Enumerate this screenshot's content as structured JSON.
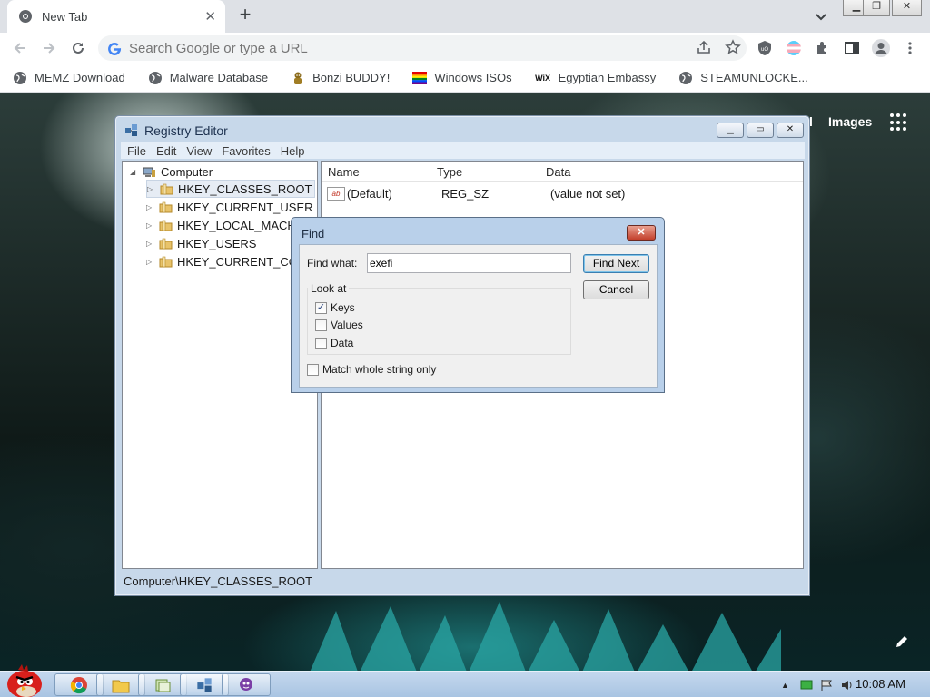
{
  "browser": {
    "tab_title": "New Tab",
    "tab_close": "✕",
    "new_tab": "+",
    "omnibox_placeholder": "Search Google or type a URL",
    "bookmarks": [
      {
        "label": "MEMZ Download",
        "icon": "globe-icon"
      },
      {
        "label": "Malware Database",
        "icon": "globe-icon"
      },
      {
        "label": "Bonzi BUDDY!",
        "icon": "bonzi-icon"
      },
      {
        "label": "Windows ISOs",
        "icon": "rainbow-flag-icon"
      },
      {
        "label": "Egyptian Embassy",
        "icon": "wix-icon"
      },
      {
        "label": "STEAMUNLOCKE...",
        "icon": "globe-icon"
      }
    ],
    "bookmark_wix_glyph": "WiX"
  },
  "newtab_page": {
    "link_partial": "l",
    "images_link": "Images"
  },
  "regedit": {
    "title": "Registry Editor",
    "menu": [
      "File",
      "Edit",
      "View",
      "Favorites",
      "Help"
    ],
    "tree_root": "Computer",
    "tree_items": [
      "HKEY_CLASSES_ROOT",
      "HKEY_CURRENT_USER",
      "HKEY_LOCAL_MACHI",
      "HKEY_USERS",
      "HKEY_CURRENT_CON"
    ],
    "columns": [
      "Name",
      "Type",
      "Data"
    ],
    "rows": [
      {
        "name": "(Default)",
        "type": "REG_SZ",
        "data": "(value not set)",
        "icon_glyph": "ab"
      }
    ],
    "status": "Computer\\HKEY_CLASSES_ROOT"
  },
  "find_dialog": {
    "title": "Find",
    "find_what_label": "Find what:",
    "find_what_value": "exefi",
    "find_next": "Find Next",
    "cancel": "Cancel",
    "look_at_label": "Look at",
    "options": [
      {
        "label": "Keys",
        "checked": true
      },
      {
        "label": "Values",
        "checked": false
      },
      {
        "label": "Data",
        "checked": false
      }
    ],
    "match_whole": {
      "label": "Match whole string only",
      "checked": false
    },
    "check_glyph": "✓"
  },
  "taskbar": {
    "time": "10:08 AM"
  },
  "colors": {
    "chrome_tabstrip": "#dee1e6",
    "win7_glass": "#c7d8ea",
    "close_red": "#c3402c",
    "taskbar": "#b5cde8"
  }
}
